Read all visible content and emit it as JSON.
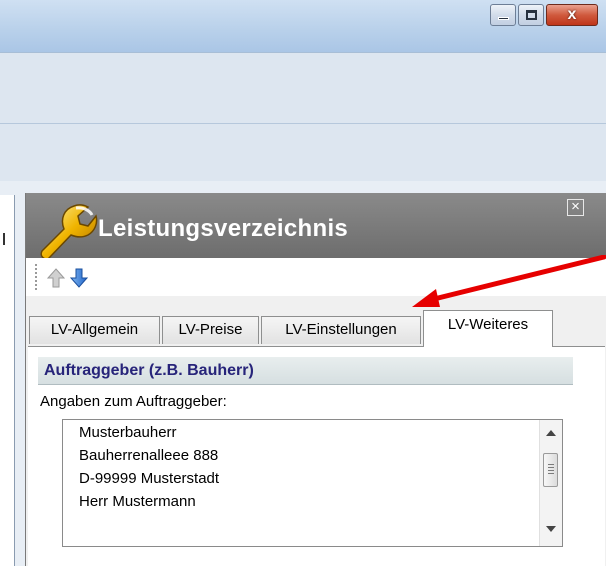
{
  "window": {
    "close_glyph": "x"
  },
  "panel": {
    "title": "Leistungsverzeichnis",
    "icon": "wrench-icon",
    "close_glyph": "×",
    "header_color": "#7a7a7a"
  },
  "toolbar": {
    "move_up_icon": "arrow-up-icon",
    "move_down_icon": "arrow-down-icon"
  },
  "tabs": [
    {
      "label": "LV-Allgemein",
      "active": false
    },
    {
      "label": "LV-Preise",
      "active": false
    },
    {
      "label": "LV-Einstellungen",
      "active": false
    },
    {
      "label": "LV-Weiteres",
      "active": true
    }
  ],
  "content": {
    "group_title": "Auftraggeber (z.B. Bauherr)",
    "field_label": "Angaben zum Auftraggeber:",
    "field_lines": [
      "Musterbauherr",
      "Bauherrenalleee 888",
      "D-99999 Musterstadt",
      "Herr Mustermann"
    ]
  },
  "colors": {
    "annotation_arrow": "#e60000",
    "group_title_text": "#27247a",
    "title_text": "#ffffff"
  }
}
